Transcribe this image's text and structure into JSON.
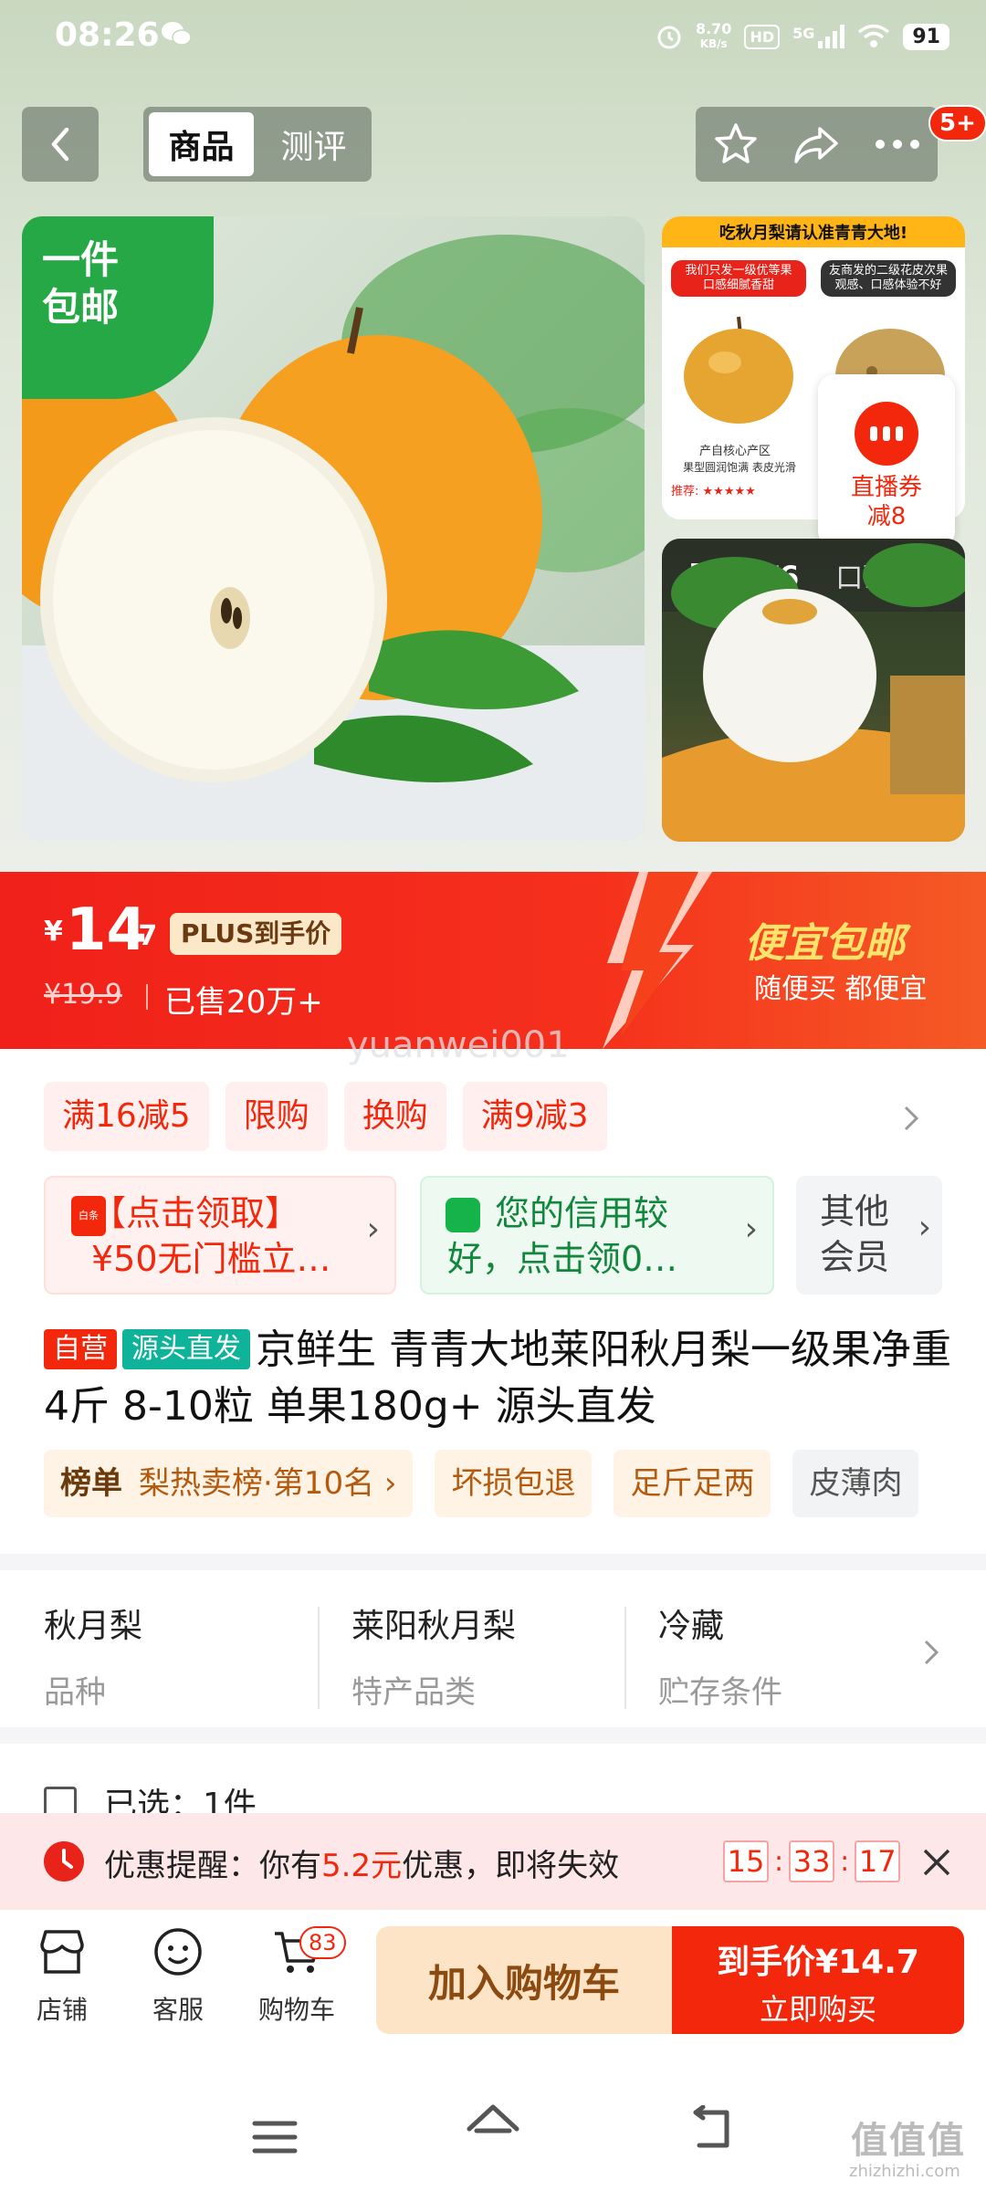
{
  "status_bar": {
    "time": "08:26",
    "speed_value": "8.70",
    "speed_unit": "KB/s",
    "hd": "HD",
    "network": "5G",
    "battery": "91"
  },
  "nav": {
    "tabs": [
      "商品",
      "测评"
    ],
    "active_tab": "商品",
    "badge": "5+"
  },
  "main_image": {
    "flag_line1": "一件",
    "flag_line2": "包邮"
  },
  "thumb1": {
    "header": "吃秋月梨请认准青青大地!",
    "left_tag": "我们只发一级优等果\n口感细腻香甜",
    "right_tag": "友商发的二级花皮次果\n观感、口感体验不好",
    "desc1": "产自核心产区",
    "desc2": "果型圆润饱满  表皮光滑",
    "recommend": "推荐: ★★★★★"
  },
  "live_coupon": {
    "line1": "直播券",
    "line2": "减8"
  },
  "gallery": {
    "active": "图集1/6",
    "other": "口碑"
  },
  "price": {
    "currency": "¥",
    "integer": "14",
    "decimal": ".7",
    "plus_label": "PLUS到手价",
    "original": "¥19.9",
    "sold": "已售20万+",
    "slogan_main": "便宜包邮",
    "slogan_sub": "随便买 都便宜"
  },
  "watermark": "yuanwei001",
  "promo_tags": [
    "满16减5",
    "限购",
    "换购",
    "满9减3"
  ],
  "coupons": {
    "red_line1": "【点击领取】",
    "red_line2": "¥50无门槛立…",
    "red_icon": "白条",
    "green_line1": "您的信用较",
    "green_line2": "好，点击领0…",
    "gray_line1": "其他",
    "gray_line2": "会员"
  },
  "product": {
    "tag_self": "自营",
    "tag_source": "源头直发",
    "title": "京鲜生 青青大地莱阳秋月梨一级果净重4斤 8-10粒 单果180g+ 源头直发"
  },
  "rank_row": {
    "rank_label": "榜单",
    "rank_value": "梨热卖榜·第10名",
    "chips": [
      "坏损包退",
      "足斤足两",
      "皮薄肉"
    ]
  },
  "attributes": [
    {
      "value": "秋月梨",
      "key": "品种"
    },
    {
      "value": "莱阳秋月梨",
      "key": "特产品类"
    },
    {
      "value": "冷藏",
      "key": "贮存条件"
    }
  ],
  "selected": "已选：1件",
  "reminder": {
    "prefix": "优惠提醒：你有",
    "amount": "5.2元",
    "suffix": "优惠，即将失效",
    "hh": "15",
    "mm": "33",
    "ss": "17"
  },
  "bottom_bar": {
    "store": "店铺",
    "service": "客服",
    "cart": "购物车",
    "cart_count": "83",
    "add_cart": "加入购物车",
    "buy_line1": "到手价¥14.7",
    "buy_line2": "立即购买"
  },
  "site": {
    "mark": "值值值",
    "url": "zhizhizhi.com"
  },
  "colors": {
    "brand_red": "#f2270c",
    "green_flag": "#26a846",
    "source_teal": "#0fb39a"
  }
}
